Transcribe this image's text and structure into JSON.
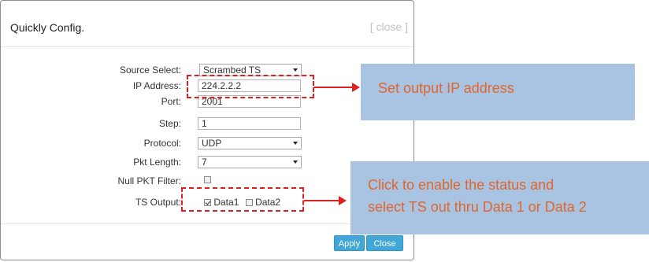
{
  "dialog": {
    "title": "Quickly Config.",
    "close_link": "[ close ]"
  },
  "form": {
    "source_select": {
      "label": "Source Select:",
      "value": "Scrambed TS"
    },
    "ip_address": {
      "label": "IP Address:",
      "value": "224.2.2.2"
    },
    "port": {
      "label": "Port:",
      "value": "2001"
    },
    "step": {
      "label": "Step:",
      "value": "1"
    },
    "protocol": {
      "label": "Protocol:",
      "value": "UDP"
    },
    "pkt_length": {
      "label": "Pkt Length:",
      "value": "7"
    },
    "null_pkt_filter": {
      "label": "Null PKT Filter:",
      "checked": false
    },
    "ts_output": {
      "label": "TS Output:",
      "options": [
        {
          "label": "Data1",
          "checked": true
        },
        {
          "label": "Data2",
          "checked": false
        }
      ]
    }
  },
  "buttons": {
    "apply": "Apply",
    "close": "Close"
  },
  "annotations": {
    "ip_callout": "Set output IP address",
    "ts_callout_line1": "Click to enable the status and",
    "ts_callout_line2": "select TS out thru Data 1 or Data 2",
    "colors": {
      "dash": "#e02020",
      "callout_bg": "#a8c4e2",
      "callout_text": "#e0662b",
      "button": "#41a7d8"
    }
  }
}
